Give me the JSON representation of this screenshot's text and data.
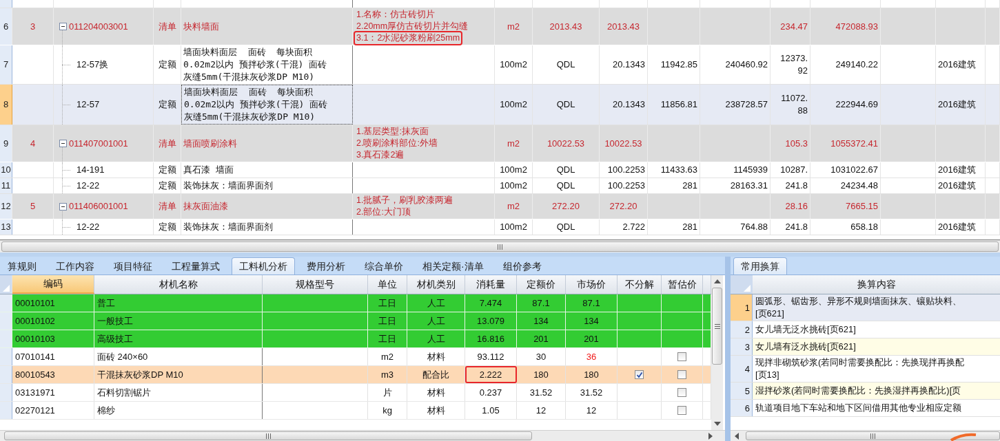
{
  "top_grid": {
    "rows": [
      {
        "number": "6",
        "seq": "3",
        "kind": "bill",
        "expanded": true,
        "code": "011204003001",
        "type": "清单",
        "name": "块料墙面",
        "focused": false,
        "selected": false,
        "features": [
          {
            "text": "1.名称：仿古砖切片",
            "marked": false
          },
          {
            "text": "2.20mm厚仿古砖切片并勾缝",
            "marked": false
          },
          {
            "text": "3.1：2水泥砂浆粉刷25mm",
            "marked": true
          }
        ],
        "values": {
          "unit": "m2",
          "column_2": "2013.43",
          "quantity": "2013.43",
          "column_6": "234.47",
          "column_7": "472088.93"
        }
      },
      {
        "number": "7",
        "kind": "quota",
        "code": "12-57换",
        "type": "定额",
        "name": "墙面块料面层  面砖  每块面积0.02m2以内 预拌砂浆(干混) 面砖灰缝5mm(干混抹灰砂浆DP M10)",
        "focused": false,
        "selected": false,
        "features": [],
        "values": {
          "unit": "100m2",
          "column_2": "QDL",
          "quantity": "20.1343",
          "unit_price": "11942.85",
          "total": "240460.92",
          "column_6": "12373.\n92",
          "column_7": "249140.22",
          "column_9": "2016建筑"
        }
      },
      {
        "number": "8",
        "kind": "quota",
        "code": "12-57",
        "type": "定额",
        "name": "墙面块料面层  面砖  每块面积0.02m2以内 预拌砂浆(干混) 面砖灰缝5mm(干混抹灰砂浆DP M10)",
        "focused": true,
        "selected": true,
        "features": [],
        "values": {
          "unit": "100m2",
          "column_2": "QDL",
          "quantity": "20.1343",
          "unit_price": "11856.81",
          "total": "238728.57",
          "column_6": "11072.\n88",
          "column_7": "222944.69",
          "column_9": "2016建筑"
        }
      },
      {
        "number": "9",
        "seq": "4",
        "kind": "bill",
        "expanded": true,
        "code": "011407001001",
        "type": "清单",
        "name": "墙面喷刷涂料",
        "focused": false,
        "selected": false,
        "features": [
          {
            "text": "1.基层类型:抹灰面",
            "marked": false
          },
          {
            "text": "2.喷刷涂料部位:外墙",
            "marked": false
          },
          {
            "text": "3.真石漆2遍",
            "marked": false
          }
        ],
        "values": {
          "unit": "m2",
          "column_2": "10022.53",
          "quantity": "10022.53",
          "column_6": "105.3",
          "column_7": "1055372.41"
        }
      },
      {
        "number": "10",
        "kind": "quota",
        "code": "14-191",
        "type": "定额",
        "name": "真石漆 墙面",
        "focused": false,
        "selected": false,
        "features": [],
        "values": {
          "unit": "100m2",
          "column_2": "QDL",
          "quantity": "100.2253",
          "unit_price": "11433.63",
          "total": "1145939",
          "column_6": "10287.",
          "column_7": "1031022.67",
          "column_9": "2016建筑"
        }
      },
      {
        "number": "11",
        "kind": "quota",
        "code": "12-22",
        "type": "定额",
        "name": "装饰抹灰：墙面界面剂",
        "focused": false,
        "selected": false,
        "features": [],
        "values": {
          "unit": "100m2",
          "column_2": "QDL",
          "quantity": "100.2253",
          "unit_price": "281",
          "total": "28163.31",
          "column_6": "241.8",
          "column_7": "24234.48",
          "column_9": "2016建筑"
        }
      },
      {
        "number": "12",
        "seq": "5",
        "kind": "bill",
        "expanded": true,
        "code": "011406001001",
        "type": "清单",
        "name": "抹灰面油漆",
        "focused": false,
        "selected": false,
        "features": [
          {
            "text": "1.批腻子，刷乳胶漆两遍",
            "marked": false
          },
          {
            "text": "2.部位:大门顶",
            "marked": false
          }
        ],
        "values": {
          "unit": "m2",
          "column_2": "272.20",
          "quantity": "272.20",
          "column_6": "28.16",
          "column_7": "7665.15"
        }
      },
      {
        "number": "13",
        "kind": "quota",
        "code": "12-22",
        "type": "定额",
        "name": "装饰抹灰：墙面界面剂",
        "focused": false,
        "selected": false,
        "features": [],
        "values": {
          "unit": "100m2",
          "column_2": "QDL",
          "quantity": "2.722",
          "unit_price": "281",
          "total": "764.88",
          "column_6": "241.8",
          "column_7": "658.18",
          "column_9": "2016建筑"
        }
      }
    ]
  },
  "tabs": [
    {
      "label": "算规则",
      "selected": false
    },
    {
      "label": "工作内容",
      "selected": false
    },
    {
      "label": "项目特征",
      "selected": false
    },
    {
      "label": "工程量算式",
      "selected": false
    },
    {
      "label": "工料机分析",
      "selected": true
    },
    {
      "label": "费用分析",
      "selected": false
    },
    {
      "label": "综合单价",
      "selected": false
    },
    {
      "label": "相关定额·清单",
      "selected": false
    },
    {
      "label": "组价参考",
      "selected": false
    }
  ],
  "analysis": {
    "columns": [
      {
        "label": "编码",
        "selected": true
      },
      {
        "label": "材机名称",
        "selected": false
      },
      {
        "label": "规格型号",
        "selected": false
      },
      {
        "label": "单位",
        "selected": false
      },
      {
        "label": "材机类别",
        "selected": false
      },
      {
        "label": "消耗量",
        "selected": false
      },
      {
        "label": "定额价",
        "selected": false
      },
      {
        "label": "市场价",
        "selected": false
      },
      {
        "label": "不分解",
        "selected": false
      },
      {
        "label": "暂估价",
        "selected": false
      }
    ],
    "rows": [
      {
        "code": "00010101",
        "name": "普工",
        "unit": "工日",
        "category": "人工",
        "kind": "labor",
        "consumption": "7.474",
        "quota_price": "87.1",
        "market_price": "87.1",
        "price_changed": false,
        "selected": false,
        "marked": false
      },
      {
        "code": "00010102",
        "name": "一般技工",
        "unit": "工日",
        "category": "人工",
        "kind": "labor",
        "consumption": "13.079",
        "quota_price": "134",
        "market_price": "134",
        "price_changed": false,
        "selected": false,
        "marked": false
      },
      {
        "code": "00010103",
        "name": "高级技工",
        "unit": "工日",
        "category": "人工",
        "kind": "labor",
        "consumption": "16.816",
        "quota_price": "201",
        "market_price": "201",
        "price_changed": false,
        "selected": false,
        "marked": false
      },
      {
        "code": "07010141",
        "name": "面砖 240×60",
        "unit": "m2",
        "category": "材料",
        "kind": "material",
        "consumption": "93.112",
        "quota_price": "30",
        "market_price": "36",
        "price_changed": true,
        "provisional": false,
        "selected": false,
        "marked": false
      },
      {
        "code": "80010543",
        "name": "干混抹灰砂浆DP M10",
        "unit": "m3",
        "category": "配合比",
        "kind": "material",
        "consumption": "2.222",
        "quota_price": "180",
        "market_price": "180",
        "price_changed": false,
        "not_split": true,
        "provisional": false,
        "selected": true,
        "marked": true
      },
      {
        "code": "03131971",
        "name": "石料切割锯片",
        "unit": "片",
        "category": "材料",
        "kind": "material",
        "consumption": "0.237",
        "quota_price": "31.52",
        "market_price": "31.52",
        "price_changed": false,
        "provisional": false,
        "selected": false,
        "marked": false
      },
      {
        "code": "02270121",
        "name": "棉纱",
        "unit": "kg",
        "category": "材料",
        "kind": "material",
        "consumption": "1.05",
        "quota_price": "12",
        "market_price": "12",
        "price_changed": false,
        "provisional": false,
        "selected": false,
        "marked": false
      }
    ]
  },
  "conversion_panel": {
    "tabs": [
      {
        "label": "常用换算",
        "selected": true
      }
    ],
    "header": "换算内容",
    "rows": [
      {
        "number": "1",
        "lines": [
          "圆弧形、锯齿形、异形不规则墙面抹灰、镶贴块料、",
          "[页621]"
        ],
        "selected": true
      },
      {
        "number": "2",
        "lines": [
          "女儿墙无泛水挑砖[页621]"
        ],
        "selected": false
      },
      {
        "number": "3",
        "lines": [
          "女儿墙有泛水挑砖[页621]"
        ],
        "selected": false
      },
      {
        "number": "4",
        "lines": [
          "现拌非砌筑砂浆(若同时需要换配比：先换现拌再换配",
          "[页13]"
        ],
        "selected": false
      },
      {
        "number": "5",
        "lines": [
          "湿拌砂浆(若同时需要换配比：先换湿拌再换配比)[页"
        ],
        "selected": false
      },
      {
        "number": "6",
        "lines": [
          "轨道项目地下车站和地下区间借用其他专业相应定额"
        ],
        "selected": false
      }
    ]
  }
}
